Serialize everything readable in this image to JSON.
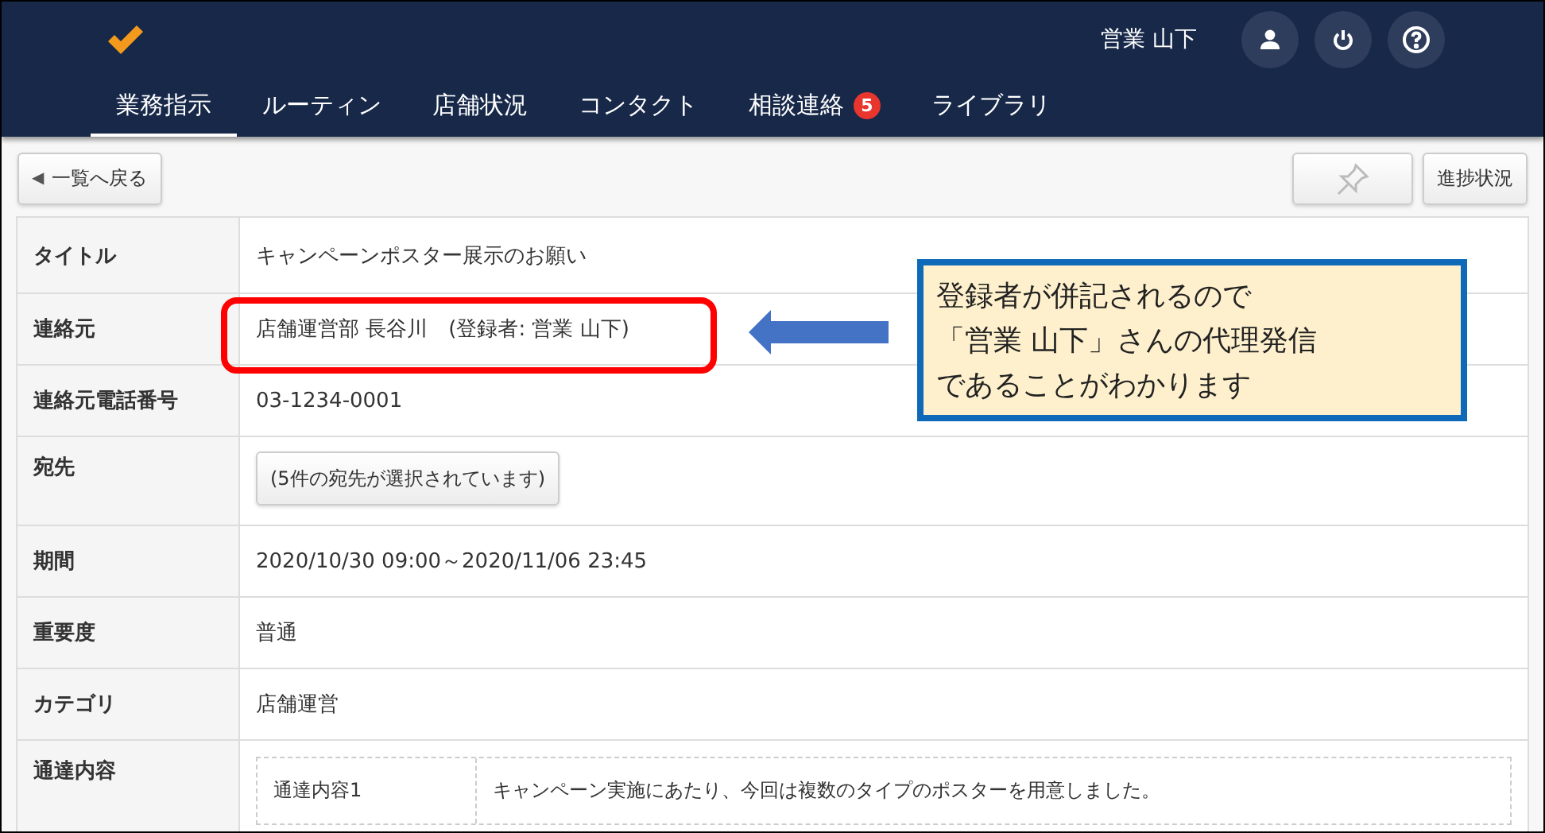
{
  "header": {
    "user_name": "営業 山下"
  },
  "tabs": [
    {
      "label": "業務指示",
      "selected": true
    },
    {
      "label": "ルーティン",
      "selected": false
    },
    {
      "label": "店舗状況",
      "selected": false
    },
    {
      "label": "コンタクト",
      "selected": false
    },
    {
      "label": "相談連絡",
      "selected": false,
      "badge": "5"
    },
    {
      "label": "ライブラリ",
      "selected": false
    }
  ],
  "toolbar": {
    "back_button": "一覧へ戻る",
    "back_glyph": "◀",
    "progress_button": "進捗状況"
  },
  "details": [
    {
      "kind": "text",
      "label": "タイトル",
      "value": "キャンペーンポスター展示のお願い"
    },
    {
      "kind": "text",
      "label": "連絡元",
      "value": "店舗運営部 長谷川　(登録者: 営業 山下)",
      "highlighted": true
    },
    {
      "kind": "text",
      "label": "連絡元電話番号",
      "value": "03-1234-0001"
    },
    {
      "kind": "button",
      "label": "宛先",
      "value": "(5件の宛先が選択されています)"
    },
    {
      "kind": "text",
      "label": "期間",
      "value": "2020/10/30 09:00～2020/11/06 23:45"
    },
    {
      "kind": "text",
      "label": "重要度",
      "value": "普通"
    },
    {
      "kind": "text",
      "label": "カテゴリ",
      "value": "店舗運営"
    },
    {
      "kind": "nested",
      "label": "通達内容",
      "items": [
        {
          "label": "通達内容1",
          "value": "キャンペーン実施にあたり、今回は複数のタイプのポスターを用意しました。"
        }
      ]
    }
  ],
  "callout": {
    "lines": [
      "登録者が併記されるので",
      "「営業 山下」さんの代理発信",
      "であることがわかります"
    ]
  }
}
